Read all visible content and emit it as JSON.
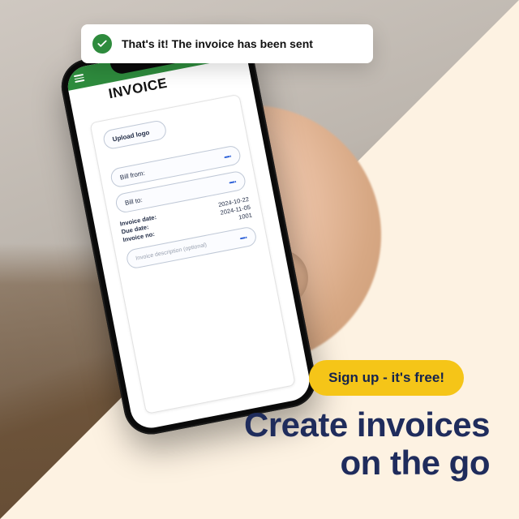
{
  "toast": {
    "message": "That's it! The invoice has been sent"
  },
  "phone": {
    "title": "INVOICE",
    "upload_label": "Upload logo",
    "bill_from_label": "Bill from:",
    "bill_to_label": "Bill to:",
    "meta": {
      "invoice_date_label": "Invoice date:",
      "invoice_date_value": "2024-10-22",
      "due_date_label": "Due date:",
      "due_date_value": "2024-11-05",
      "invoice_no_label": "Invoice no:",
      "invoice_no_value": "1001"
    },
    "description_placeholder": "Invoice description (optional)"
  },
  "cta": {
    "label": "Sign up - it's free!"
  },
  "headline": {
    "line1": "Create invoices",
    "line2": "on the go"
  },
  "colors": {
    "accent_green": "#2e8b3d",
    "cta_yellow": "#f5c518",
    "navy": "#1f2c5c",
    "cream": "#fdf2e2"
  }
}
